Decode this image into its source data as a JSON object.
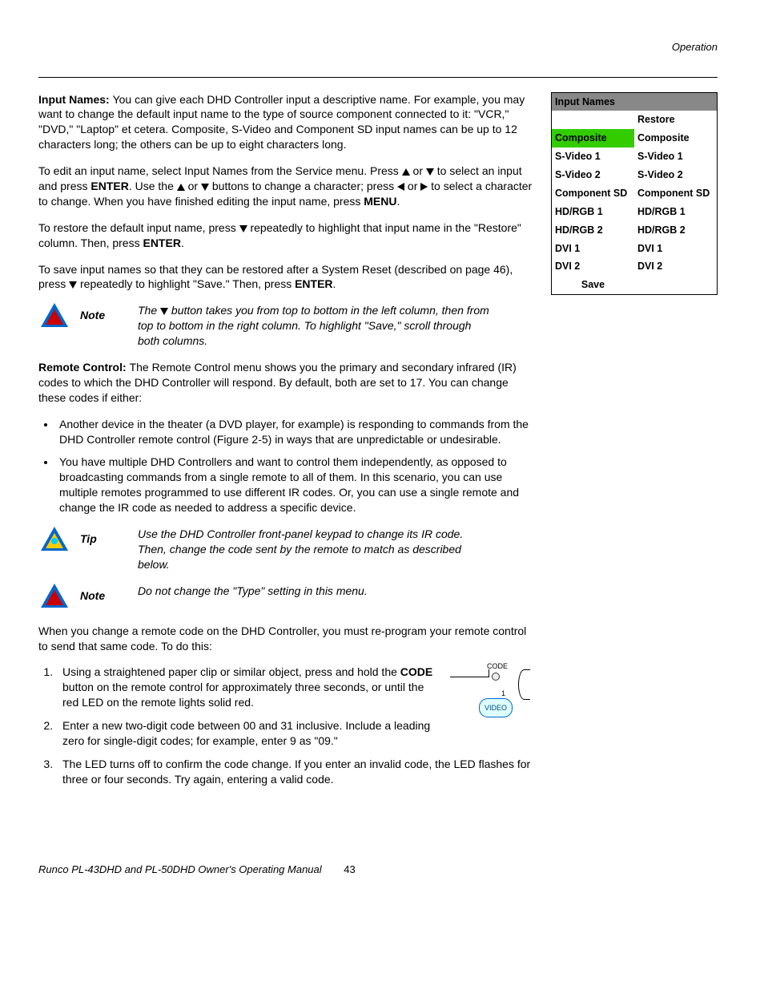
{
  "header": {
    "section": "Operation"
  },
  "para1": {
    "lead": "Input Names: ",
    "text": "You can give each DHD Controller input a descriptive name. For example, you may want to change the default input name to the type of source component connected to it: \"VCR,\" \"DVD,\" \"Laptop\" et cetera. Composite, S-Video and Component SD input names can be up to 12 characters long; the others can be up to eight characters long."
  },
  "para2": {
    "t1": "To edit an input name, select Input Names from the Service menu. Press ",
    "t2": " or ",
    "t3": " to select an input and press ",
    "enter": "ENTER",
    "t4": ". Use the ",
    "t5": " or ",
    "t6": " buttons to change a character; press ",
    "t7": " or ",
    "t8": " to select a character to change. When you have finished editing the input name, press ",
    "menu": "MENU",
    "t9": "."
  },
  "para3": {
    "t1": "To restore the default input name, press ",
    "t2": " repeatedly to highlight that input name in the \"Restore\" column. Then, press ",
    "enter": "ENTER",
    "t3": "."
  },
  "para4": {
    "t1": "To save input names so that they can be restored after a System Reset (described on page 46), press ",
    "t2": " repeatedly to highlight \"Save.\" Then, press ",
    "enter": "ENTER",
    "t3": "."
  },
  "note1": {
    "label": "Note",
    "t1": "The ",
    "t2": " button takes you from top to bottom in the left column, then from top to bottom in the right column. To highlight \"Save,\" scroll through both columns."
  },
  "para5": {
    "lead": "Remote Control: ",
    "text": "The Remote Control menu shows you the primary and secondary infrared (IR) codes to which the DHD Controller will respond. By default, both are set to 17. You can change these codes if either:"
  },
  "bullets": {
    "b1": "Another device in the theater (a DVD player, for example) is responding to commands from the DHD Controller remote control (Figure 2-5) in ways that are unpredictable or undesirable.",
    "b2": "You have multiple DHD Controllers and want to control them independently, as opposed to broadcasting commands from a single remote to all of them. In this scenario, you can use multiple remotes programmed to use different IR codes. Or, you can use a single remote and change the IR code as needed to address a specific device."
  },
  "tip": {
    "label": "Tip",
    "text": "Use the DHD Controller front-panel keypad to change its IR code. Then, change the code sent by the remote to match as described below."
  },
  "note2": {
    "label": "Note",
    "text": "Do not change the \"Type\" setting in this menu."
  },
  "para6": "When you change a remote code on the DHD Controller, you must re-program your remote control to send that same code. To do this:",
  "steps": {
    "s1a": "Using a straightened paper clip or similar object, press and hold the ",
    "s1b": "CODE",
    "s1c": " button on the remote control for approximately three seconds, or until the red LED on the remote lights solid red.",
    "s2": "Enter a new two-digit code between 00 and 31 inclusive. Include a leading zero for single-digit codes; for example, enter 9 as \"09.\"",
    "s3": "The LED turns off to confirm the code change. If you enter an invalid code, the LED flashes for three or four seconds. Try again, entering a valid code."
  },
  "table": {
    "title": "Input Names",
    "restore": "Restore",
    "rows": [
      [
        "Composite",
        "Composite"
      ],
      [
        "S-Video 1",
        "S-Video 1"
      ],
      [
        "S-Video 2",
        "S-Video 2"
      ],
      [
        "Component SD",
        "Component SD"
      ],
      [
        "HD/RGB 1",
        "HD/RGB 1"
      ],
      [
        "HD/RGB 2",
        "HD/RGB 2"
      ],
      [
        "DVI 1",
        "DVI 1"
      ],
      [
        "DVI 2",
        "DVI 2"
      ]
    ],
    "save": "Save"
  },
  "diagram": {
    "code": "CODE",
    "one": "1",
    "video": "VIDEO"
  },
  "footer": {
    "title": "Runco PL-43DHD and PL-50DHD Owner's Operating Manual",
    "page": "43"
  }
}
